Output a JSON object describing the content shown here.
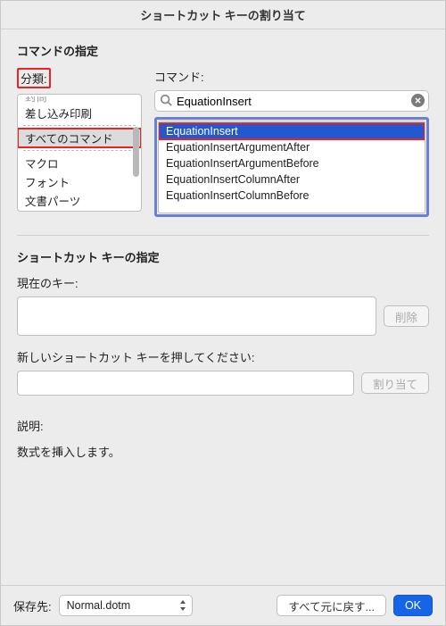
{
  "window": {
    "title": "ショートカット キーの割り当て"
  },
  "specify_command": {
    "heading": "コマンドの指定",
    "category_label": "分類:",
    "command_label": "コマンド:",
    "categories": [
      "封筒",
      "差し込み印刷",
      "すべてのコマンド",
      "マクロ",
      "フォント",
      "文書パーツ"
    ],
    "selected_category_index": 2,
    "search_value": "EquationInsert",
    "commands": [
      "EquationInsert",
      "EquationInsertArgumentAfter",
      "EquationInsertArgumentBefore",
      "EquationInsertColumnAfter",
      "EquationInsertColumnBefore"
    ],
    "selected_command_index": 0
  },
  "shortcut": {
    "heading": "ショートカット キーの指定",
    "current_label": "現在のキー:",
    "delete_label": "削除",
    "new_label": "新しいショートカット キーを押してください:",
    "assign_label": "割り当て"
  },
  "description": {
    "label": "説明:",
    "text": "数式を挿入します。"
  },
  "footer": {
    "save_in_label": "保存先:",
    "save_in_value": "Normal.dotm",
    "reset_label": "すべて元に戻す...",
    "ok_label": "OK"
  }
}
